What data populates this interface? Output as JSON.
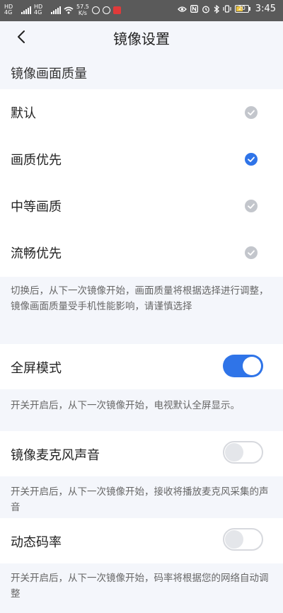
{
  "status_bar": {
    "network_left_1": "HD 4G",
    "network_left_2": "HD 4G",
    "speed_value": "57.5",
    "speed_unit": "K/s",
    "battery": "20",
    "time": "3:45"
  },
  "header": {
    "title": "镜像设置"
  },
  "quality": {
    "section_title": "镜像画面质量",
    "options": [
      {
        "label": "默认",
        "selected": false
      },
      {
        "label": "画质优先",
        "selected": true
      },
      {
        "label": "中等画质",
        "selected": false
      },
      {
        "label": "流畅优先",
        "selected": false
      }
    ],
    "note": "切换后，从下一次镜像开始，画面质量将根据选择进行调整，镜像画面质量受手机性能影响，请谨慎选择"
  },
  "fullscreen": {
    "label": "全屏模式",
    "on": true,
    "note": "开关开启后，从下一次镜像开始，电视默认全屏显示。"
  },
  "mic": {
    "label": "镜像麦克风声音",
    "on": false,
    "note": "开关开启后，从下一次镜像开始，接收将播放麦克风采集的声音"
  },
  "dynamic_bitrate": {
    "label": "动态码率",
    "on": false,
    "note": "开关开启后，从下一次镜像开始，码率将根据您的网络自动调整"
  },
  "colors": {
    "accent": "#2f74e8",
    "check_inactive": "#c3c6cc",
    "background": "#f4f6fb"
  }
}
